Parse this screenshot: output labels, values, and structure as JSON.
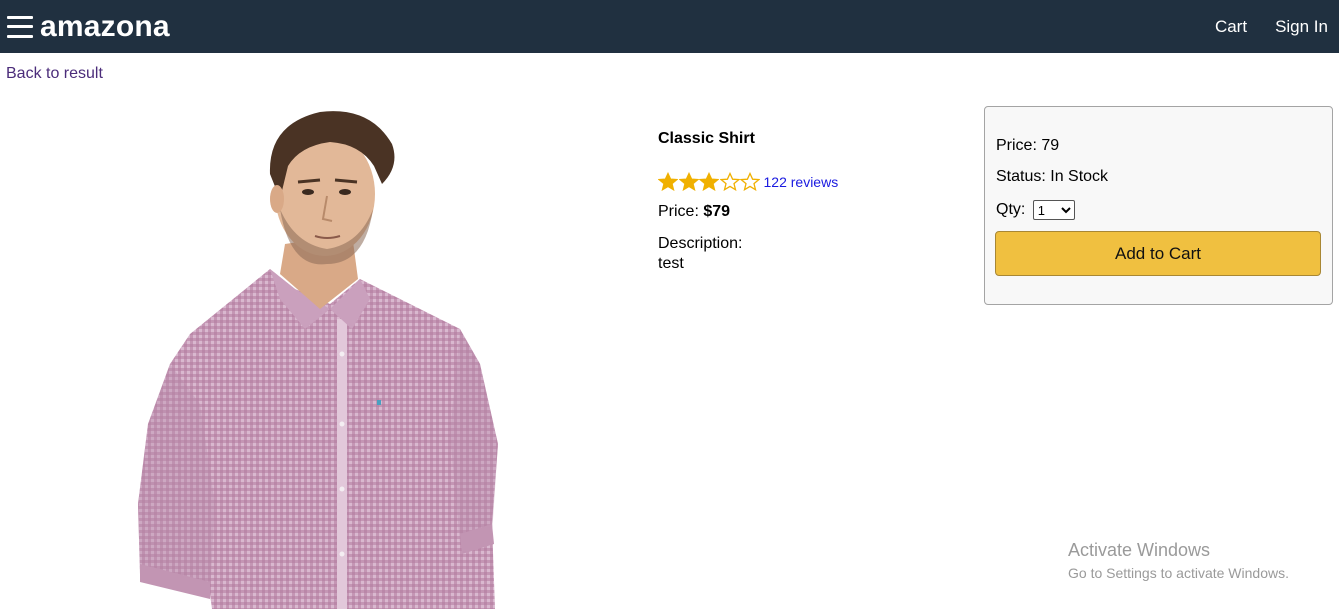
{
  "header": {
    "brand": "amazona",
    "nav": {
      "cart": "Cart",
      "sign_in": "Sign In"
    },
    "colors": {
      "background": "#203040",
      "text": "#ffffff"
    }
  },
  "back_link": "Back to result",
  "product": {
    "image_alt": "Classic Shirt",
    "name": "Classic Shirt",
    "rating": 3,
    "rating_max": 5,
    "reviews": "122 reviews",
    "price_label": "Price: ",
    "price_value": "$79",
    "description_label": "Description:",
    "description": "test"
  },
  "cart_box": {
    "price": "Price: 79",
    "status": "Status: In Stock",
    "qty_label": "Qty:",
    "qty_selected": "1",
    "add_button": "Add to Cart",
    "colors": {
      "button": "#f0c040"
    }
  },
  "watermark": {
    "title": "Activate Windows",
    "subtitle": "Go to Settings to activate Windows."
  }
}
